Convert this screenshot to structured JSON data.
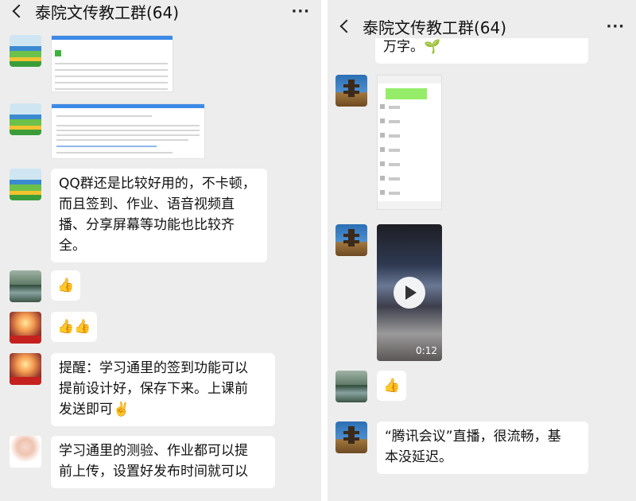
{
  "left": {
    "header": {
      "title": "泰院文传教工群(64)",
      "more": "···"
    },
    "messages": [
      {
        "type": "screenshot"
      },
      {
        "type": "screenshot"
      },
      {
        "type": "text",
        "lines": [
          "QQ群还是比较好用的，不卡顿，",
          "而且签到、作业、语音视频直",
          "播、分享屏幕等功能也比较齐",
          "全。"
        ]
      },
      {
        "type": "emoji",
        "emoji": [
          "👍"
        ]
      },
      {
        "type": "emoji",
        "emoji": [
          "👍",
          "👍"
        ]
      },
      {
        "type": "text",
        "lines": [
          "提醒：学习通里的签到功能可以",
          "提前设计好，保存下来。上课前",
          "发送即可✌️"
        ]
      },
      {
        "type": "text",
        "lines": [
          "学习通里的测验、作业都可以提",
          "前上传，设置好发布时间就可以"
        ]
      }
    ]
  },
  "right": {
    "header": {
      "title": "泰院文传教工群(64)",
      "more": "···"
    },
    "top_partial_text": "万字。🌱",
    "messages": [
      {
        "type": "phone-screenshot"
      },
      {
        "type": "video",
        "duration": "0:12"
      },
      {
        "type": "emoji",
        "emoji": [
          "👍"
        ]
      },
      {
        "type": "text",
        "lines": [
          "“腾讯会议”直播，很流畅，基",
          "本没延迟。"
        ]
      }
    ]
  },
  "icons": {
    "back": "chevron-left-icon",
    "more": "more-dots-icon",
    "play": "play-icon"
  }
}
